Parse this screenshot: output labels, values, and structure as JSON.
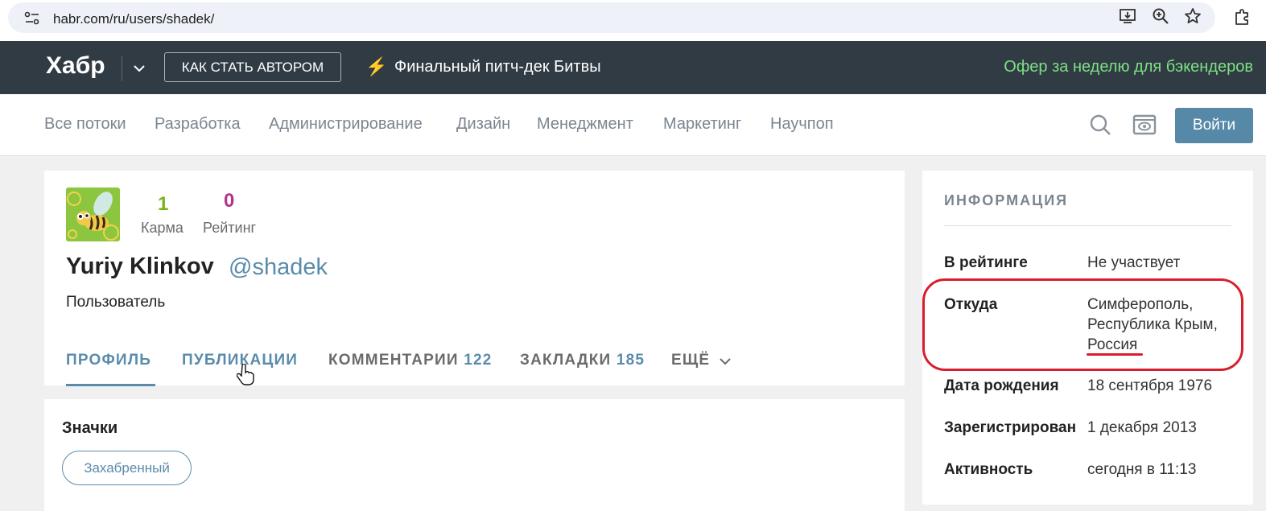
{
  "browser": {
    "url": "habr.com/ru/users/shadek/",
    "icons": [
      "site-info-icon",
      "install-app-icon",
      "zoom-icon",
      "bookmark-star-icon",
      "extensions-icon"
    ]
  },
  "header": {
    "logo": "Хабр",
    "author_button": "КАК СТАТЬ АВТОРОМ",
    "promo_icon": "lightning-icon",
    "promo_text": "Финальный питч-дек Битвы",
    "offer_text": "Офер за неделю для бэкендеров"
  },
  "nav": {
    "items": [
      "Все потоки",
      "Разработка",
      "Администрирование",
      "Дизайн",
      "Менеджмент",
      "Маркетинг",
      "Научпоп"
    ],
    "login": "Войти"
  },
  "profile": {
    "karma_value": "1",
    "karma_label": "Карма",
    "rating_value": "0",
    "rating_label": "Рейтинг",
    "name": "Yuriy Klinkov",
    "handle": "@shadek",
    "role": "Пользователь",
    "tabs": [
      {
        "label": "ПРОФИЛЬ",
        "count": ""
      },
      {
        "label": "ПУБЛИКАЦИИ",
        "count": ""
      },
      {
        "label": "КОММЕНТАРИИ",
        "count": "122"
      },
      {
        "label": "ЗАКЛАДКИ",
        "count": "185"
      },
      {
        "label": "ЕЩЁ",
        "count": ""
      }
    ],
    "active_tab": "ПРОФИЛЬ"
  },
  "badges": {
    "title": "Значки",
    "items": [
      "Захабренный"
    ]
  },
  "info": {
    "title": "ИНФОРМАЦИЯ",
    "rows": [
      {
        "label": "В рейтинге",
        "value": "Не участвует"
      },
      {
        "label": "Откуда",
        "value_lines": [
          "Симферополь,",
          "Республика Крым,",
          "Россия"
        ]
      },
      {
        "label": "Дата рождения",
        "value": "18 сентября 1976"
      },
      {
        "label": "Зарегистрирован",
        "value": "1 декабря 2013"
      },
      {
        "label": "Активность",
        "value": "сегодня в 11:13"
      }
    ]
  },
  "colors": {
    "header_bg": "#303b44",
    "accent": "#5a8bab",
    "karma": "#7ab317",
    "rating": "#b3338c",
    "offer": "#7ee083",
    "annotation": "#d81e2c"
  }
}
